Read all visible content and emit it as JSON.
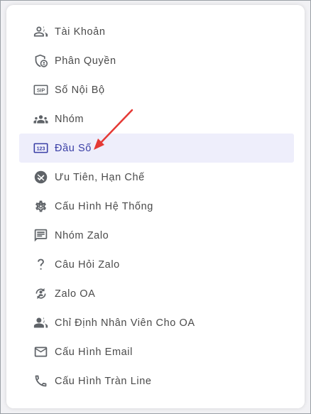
{
  "menu": {
    "items": [
      {
        "label": "Tài Khoản",
        "icon": "users-icon"
      },
      {
        "label": "Phân Quyền",
        "icon": "shield-user-icon"
      },
      {
        "label": "Số Nội Bộ",
        "icon": "sip-icon"
      },
      {
        "label": "Nhóm",
        "icon": "group-icon"
      },
      {
        "label": "Đầu Số",
        "icon": "numbers-123-icon",
        "active": true
      },
      {
        "label": "Ưu Tiên, Hạn Chế",
        "icon": "priority-icon"
      },
      {
        "label": "Cấu Hình Hệ Thống",
        "icon": "gear-icon"
      },
      {
        "label": "Nhóm Zalo",
        "icon": "chat-icon"
      },
      {
        "label": "Câu Hỏi Zalo",
        "icon": "question-icon"
      },
      {
        "label": "Zalo OA",
        "icon": "person-sync-icon"
      },
      {
        "label": "Chỉ Định Nhân Viên Cho OA",
        "icon": "users-icon"
      },
      {
        "label": "Cấu Hình Email",
        "icon": "mail-icon"
      },
      {
        "label": "Cấu Hình Tràn Line",
        "icon": "phone-icon"
      }
    ]
  },
  "colors": {
    "active_bg": "#eeeefb",
    "active_text": "#3a3fa6",
    "icon": "#5f6368",
    "arrow": "#e53935"
  }
}
